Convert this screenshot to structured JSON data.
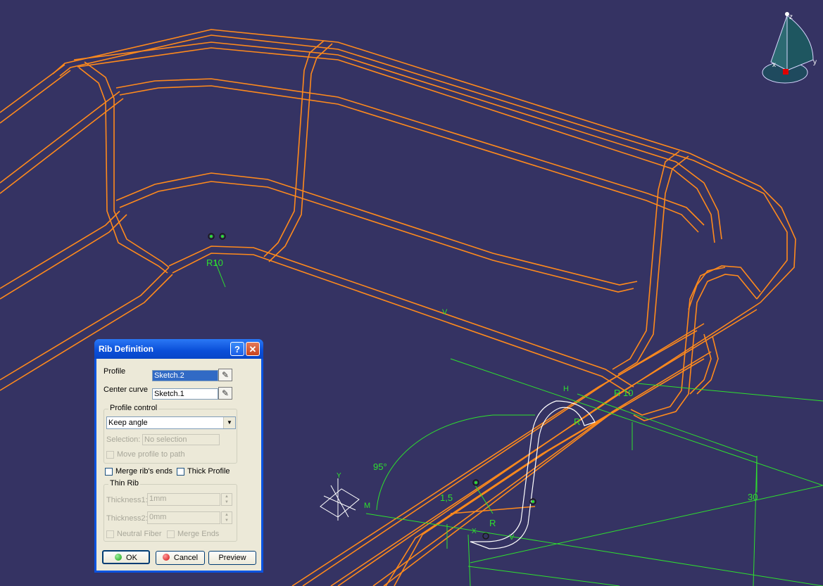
{
  "viewport": {
    "dimensions": {
      "r_left": "R10",
      "r_right": "R 10",
      "r_mid": "R",
      "r_low": "R",
      "angle": "95°",
      "thickness": "1,5",
      "height": "30"
    },
    "labels": {
      "v_top": "V",
      "v_low": "V",
      "h": "H",
      "m": "M",
      "y": "Y",
      "x": "X"
    },
    "compass": {
      "z": "z",
      "x": "x",
      "y": "y"
    }
  },
  "dialog": {
    "title": "Rib Definition",
    "help": "?",
    "close": "✕",
    "profile_label": "Profile",
    "profile_value": "Sketch.2",
    "center_curve_label": "Center curve",
    "center_curve_value": "Sketch.1",
    "profile_control": {
      "group_label": "Profile control",
      "mode_value": "Keep angle",
      "selection_label": "Selection:",
      "selection_value": "No selection",
      "move_profile_label": "Move profile to path"
    },
    "merge_ends_label": "Merge rib's ends",
    "thick_profile_label": "Thick Profile",
    "thin_rib": {
      "group_label": "Thin Rib",
      "thickness1_label": "Thickness1:",
      "thickness1_value": "1mm",
      "thickness2_label": "Thickness2:",
      "thickness2_value": "0mm",
      "neutral_fiber_label": "Neutral Fiber",
      "merge_ends_label": "Merge Ends"
    },
    "buttons": {
      "ok": "OK",
      "cancel": "Cancel",
      "preview": "Preview"
    }
  },
  "colors": {
    "background": "#353363",
    "geometry": "#ff8a1c",
    "sketch": "#2ee02e",
    "profile": "#ffffff",
    "title_bar": "#0a53e0"
  }
}
